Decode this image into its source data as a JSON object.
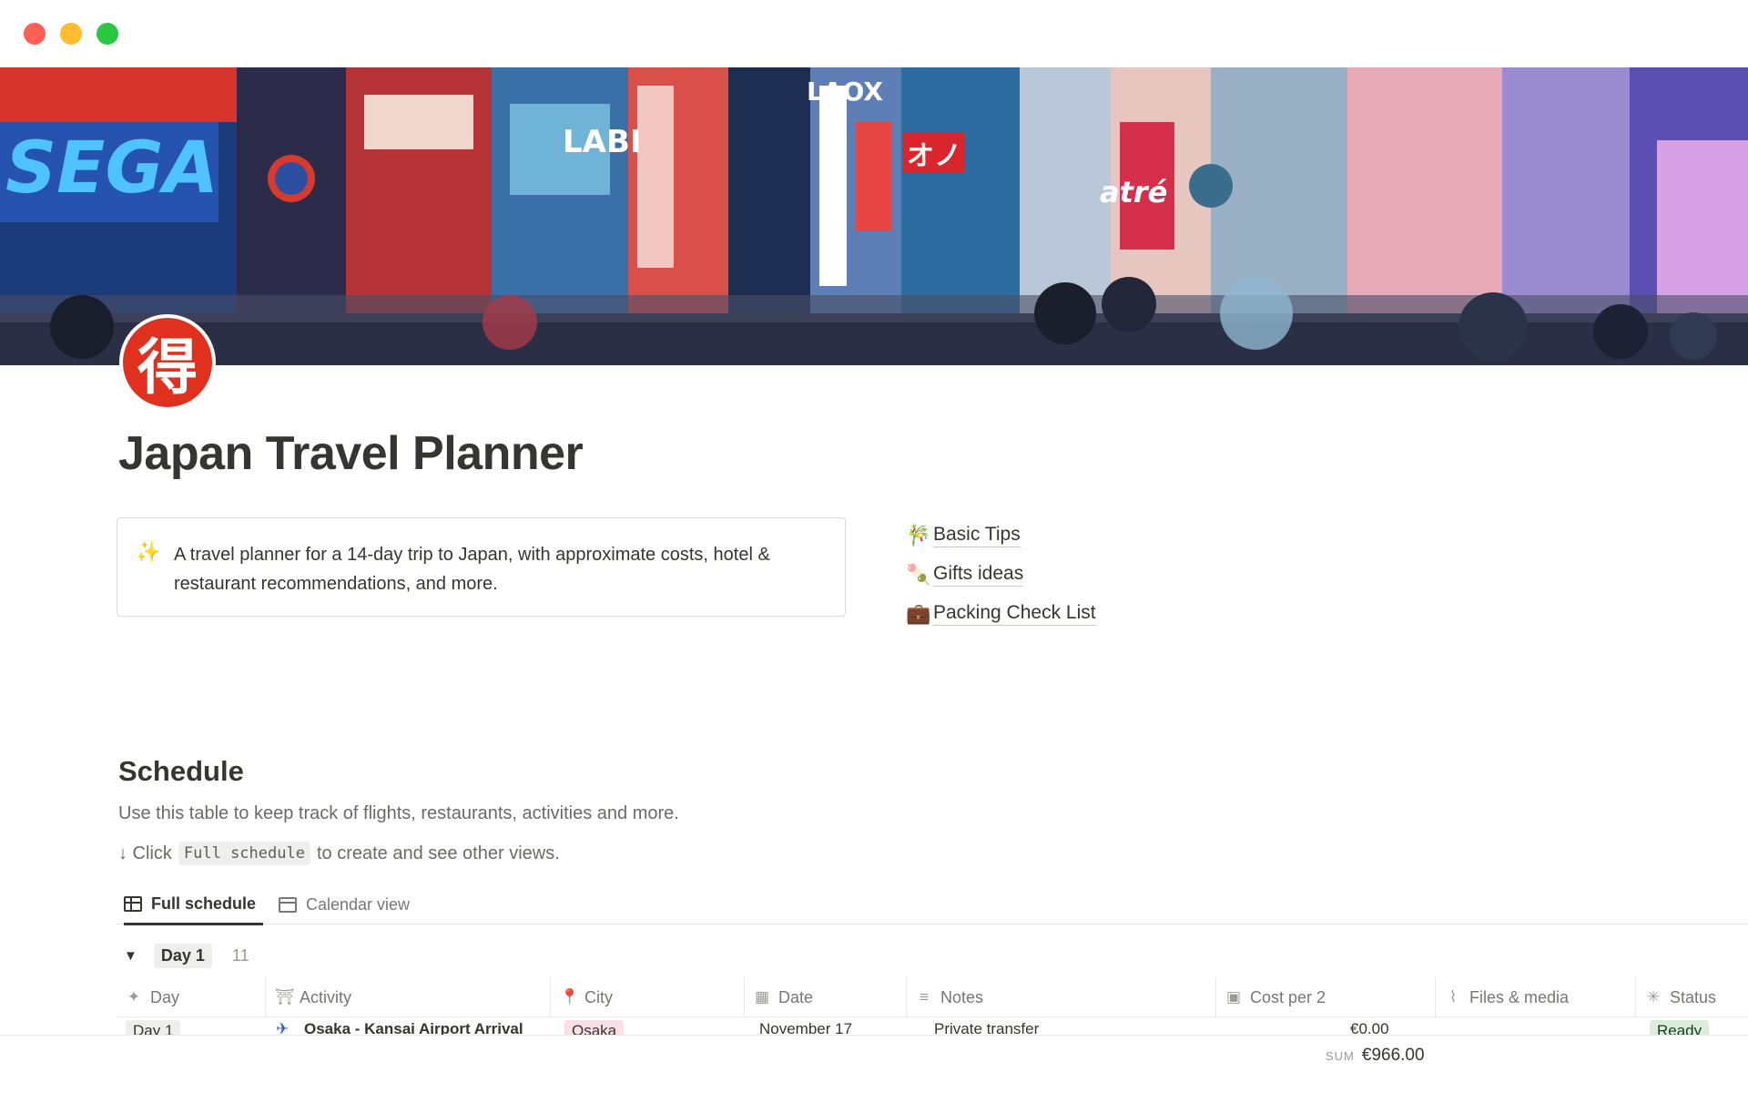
{
  "cover": {
    "signs": [
      "SEGA",
      "LAOX",
      "LABI",
      "オノ",
      "atré"
    ]
  },
  "page": {
    "icon": "得",
    "title": "Japan Travel Planner"
  },
  "callout": {
    "icon": "sparkles-icon",
    "text": "A travel planner for a 14-day trip to Japan, with approximate costs, hotel & restaurant recommendations, and more."
  },
  "links": [
    {
      "icon": "🎋",
      "label": "Basic Tips"
    },
    {
      "icon": "🍡",
      "label": "Gifts ideas"
    },
    {
      "icon": "💼",
      "label": "Packing Check List"
    }
  ],
  "schedule": {
    "title": "Schedule",
    "description": "Use this table to keep track of flights, restaurants, activities and more.",
    "hint_prefix": "↓ Click",
    "hint_code": "Full schedule",
    "hint_suffix": "to create and see other views.",
    "tabs": [
      {
        "label": "Full schedule",
        "active": true
      },
      {
        "label": "Calendar view",
        "active": false
      }
    ],
    "group": {
      "label": "Day 1",
      "count": "11"
    },
    "columns": [
      "Day",
      "Activity",
      "City",
      "Date",
      "Notes",
      "Cost per 2",
      "Files & media",
      "Status"
    ],
    "row": {
      "day": "Day 1",
      "activity": "Osaka - Kansai Airport Arrival",
      "city": "Osaka",
      "date": "November 17",
      "notes": "Private transfer",
      "cost": "€0.00",
      "status": "Ready"
    },
    "sum_label": "SUM",
    "sum_value": "€966.00"
  },
  "colors": {
    "close": "#fe5f57",
    "minimize": "#febc2e",
    "maximize": "#28c840",
    "city_pill": "#f9dfe6",
    "status_pill": "#dbeddb"
  }
}
